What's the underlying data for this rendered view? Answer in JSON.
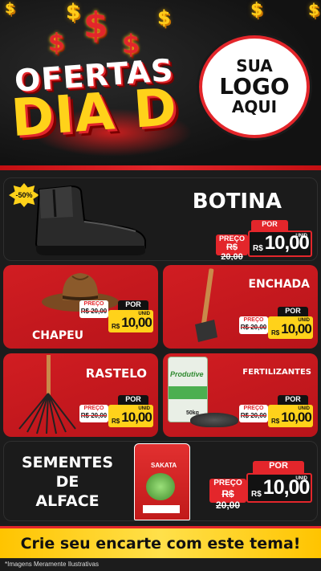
{
  "header": {
    "headline_top": "OFERTAS",
    "headline_bottom": "DIA D",
    "logo_line1": "SUA",
    "logo_line2": "LOGO",
    "logo_line3": "AQUI",
    "currency_glyph": "$"
  },
  "products": {
    "botina": {
      "title": "BOTINA",
      "discount": "-50%",
      "old_label": "PREÇO",
      "old_price": "R$ 20,00",
      "por_label": "POR",
      "currency": "R$",
      "price": "10,00",
      "unit": "UNID"
    },
    "chapeu": {
      "title": "CHAPEU",
      "old_label": "PREÇO",
      "old_price": "R$ 20,00",
      "por_label": "POR",
      "currency": "R$",
      "price": "10,00",
      "unit": "UNID"
    },
    "enchada": {
      "title": "ENCHADA",
      "old_label": "PREÇO",
      "old_price": "R$ 20,00",
      "por_label": "POR",
      "currency": "R$",
      "price": "10,00",
      "unit": "UNID"
    },
    "rastelo": {
      "title": "RASTELO",
      "old_label": "PREÇO",
      "old_price": "R$ 20,00",
      "por_label": "POR",
      "currency": "R$",
      "price": "10,00",
      "unit": "UNID"
    },
    "fertilizantes": {
      "title": "FERTILIZANTES",
      "old_label": "PREÇO",
      "old_price": "R$ 20,00",
      "por_label": "POR",
      "currency": "R$",
      "price": "10,00",
      "unit": "UNID",
      "bag_brand": "Produtive",
      "bag_weight": "50kg"
    },
    "sementes": {
      "title_line1": "SEMENTES",
      "title_line2": "DE",
      "title_line3": "ALFACE",
      "old_label": "PREÇO",
      "old_price": "R$ 20,00",
      "por_label": "POR",
      "currency": "R$",
      "price": "10,00",
      "unit": "UNID",
      "pack_brand": "SAKATA"
    }
  },
  "footer": {
    "cta_label": "Crie seu encarte com este tema!",
    "disclaimer": "*Imagens Meramente Ilustrativas"
  },
  "colors": {
    "red": "#e3262b",
    "yellow": "#ffd21a",
    "dark": "#1b1b1b"
  }
}
